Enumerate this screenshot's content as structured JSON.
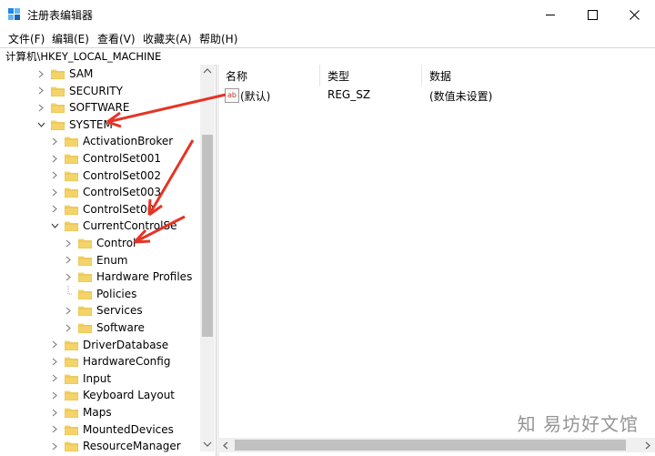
{
  "window": {
    "title": "注册表编辑器",
    "close_glyph": "✕",
    "maximize_glyph": "☐",
    "minimize_glyph": "—"
  },
  "menu": {
    "items": [
      "文件(F)",
      "编辑(E)",
      "查看(V)",
      "收藏夹(A)",
      "帮助(H)"
    ]
  },
  "address": {
    "path": "计算机\\HKEY_LOCAL_MACHINE"
  },
  "tree": {
    "items": [
      {
        "label": "SAM",
        "expanded": false,
        "level": 0
      },
      {
        "label": "SECURITY",
        "expanded": false,
        "level": 0
      },
      {
        "label": "SOFTWARE",
        "expanded": false,
        "level": 0
      },
      {
        "label": "SYSTEM",
        "expanded": true,
        "level": 0
      },
      {
        "label": "ActivationBroker",
        "expanded": false,
        "level": 1
      },
      {
        "label": "ControlSet001",
        "expanded": false,
        "level": 1
      },
      {
        "label": "ControlSet002",
        "expanded": false,
        "level": 1
      },
      {
        "label": "ControlSet003",
        "expanded": false,
        "level": 1
      },
      {
        "label": "ControlSet00",
        "expanded": false,
        "level": 1
      },
      {
        "label": "CurrentControlSe",
        "expanded": true,
        "level": 1
      },
      {
        "label": "Control",
        "expanded": false,
        "level": 2
      },
      {
        "label": "Enum",
        "expanded": false,
        "level": 2
      },
      {
        "label": "Hardware Profiles",
        "expanded": false,
        "level": 2
      },
      {
        "label": "Policies",
        "expanded": false,
        "level": 2
      },
      {
        "label": "Services",
        "expanded": false,
        "level": 2
      },
      {
        "label": "Software",
        "expanded": false,
        "level": 2
      },
      {
        "label": "DriverDatabase",
        "expanded": false,
        "level": 1
      },
      {
        "label": "HardwareConfig",
        "expanded": false,
        "level": 1
      },
      {
        "label": "Input",
        "expanded": false,
        "level": 1
      },
      {
        "label": "Keyboard Layout",
        "expanded": false,
        "level": 1
      },
      {
        "label": "Maps",
        "expanded": false,
        "level": 1
      },
      {
        "label": "MountedDevices",
        "expanded": false,
        "level": 1
      },
      {
        "label": "ResourceManager",
        "expanded": false,
        "level": 1
      }
    ]
  },
  "list": {
    "headers": {
      "name": "名称",
      "type": "类型",
      "data": "数据"
    },
    "rows": [
      {
        "icon": "ab",
        "name": "(默认)",
        "type": "REG_SZ",
        "data": "(数值未设置)"
      }
    ]
  },
  "watermark": {
    "text": "知 易坊好文馆"
  },
  "colors": {
    "folder": "#f4d46a",
    "folder_dark": "#dcb13b",
    "arrow": "#e53426",
    "scroll_thumb": "#c1c1c1"
  }
}
